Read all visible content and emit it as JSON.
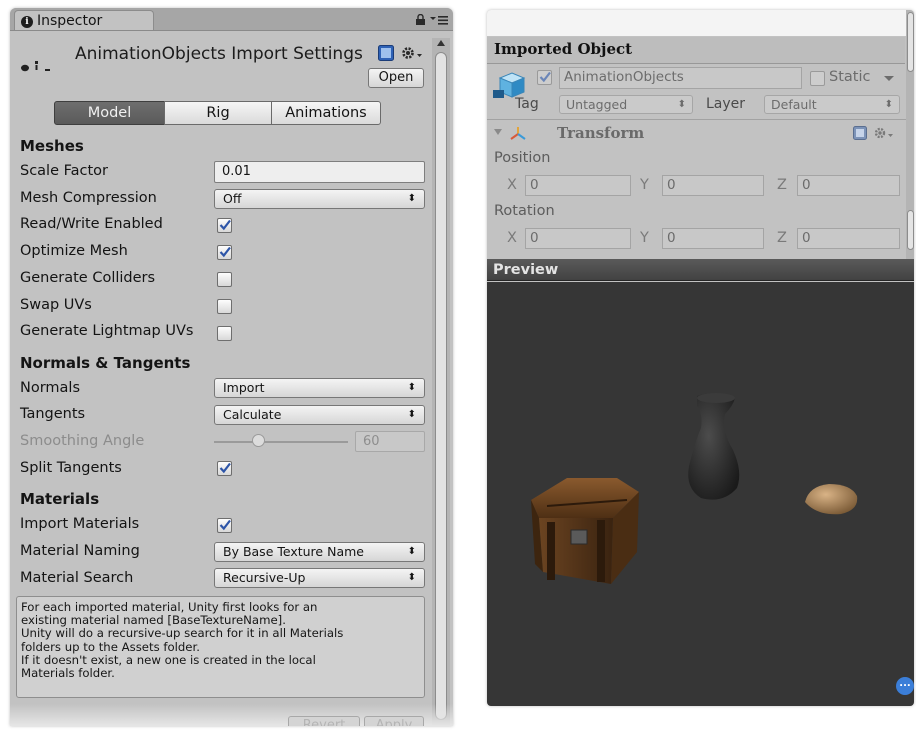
{
  "left_panel": {
    "tab_title": "Inspector",
    "header_title": "AnimationObjects Import Settings",
    "open_label": "Open",
    "tabs": [
      "Model",
      "Rig",
      "Animations"
    ],
    "active_tab": "Model",
    "meshes": {
      "heading": "Meshes",
      "scale_factor_label": "Scale Factor",
      "scale_factor_value": "0.01",
      "mesh_compression_label": "Mesh Compression",
      "mesh_compression_value": "Off",
      "read_write_label": "Read/Write Enabled",
      "read_write_checked": true,
      "optimize_mesh_label": "Optimize Mesh",
      "optimize_mesh_checked": true,
      "generate_colliders_label": "Generate Colliders",
      "generate_colliders_checked": false,
      "swap_uvs_label": "Swap UVs",
      "swap_uvs_checked": false,
      "lightmap_uvs_label": "Generate Lightmap UVs",
      "lightmap_uvs_checked": false
    },
    "normals": {
      "heading": "Normals & Tangents",
      "normals_label": "Normals",
      "normals_value": "Import",
      "tangents_label": "Tangents",
      "tangents_value": "Calculate",
      "smoothing_label": "Smoothing Angle",
      "smoothing_value": "60",
      "smoothing_fraction": 0.33,
      "split_tangents_label": "Split Tangents",
      "split_tangents_checked": true
    },
    "materials": {
      "heading": "Materials",
      "import_label": "Import Materials",
      "import_checked": true,
      "naming_label": "Material Naming",
      "naming_value": "By Base Texture Name",
      "search_label": "Material Search",
      "search_value": "Recursive-Up"
    },
    "help_lines": [
      "For each imported material, Unity first looks for an",
      "existing material named [BaseTextureName].",
      "Unity will do a recursive-up search for it in all Materials",
      "folders up to the Assets folder.",
      "If it doesn't exist, a new one is created in the local",
      "Materials folder."
    ],
    "revert_label": "Revert",
    "apply_label": "Apply"
  },
  "right_panel": {
    "title": "Imported Object",
    "object_name": "AnimationObjects",
    "static_label": "Static",
    "tag_label": "Tag",
    "tag_value": "Untagged",
    "layer_label": "Layer",
    "layer_value": "Default",
    "transform_label": "Transform",
    "position_label": "Position",
    "rotation_label": "Rotation",
    "axis_x": "X",
    "axis_y": "Y",
    "axis_z": "Z",
    "position": [
      "0",
      "0",
      "0"
    ],
    "rotation": [
      "0",
      "0",
      "0"
    ],
    "preview_label": "Preview",
    "preview_bg": "#363636"
  }
}
